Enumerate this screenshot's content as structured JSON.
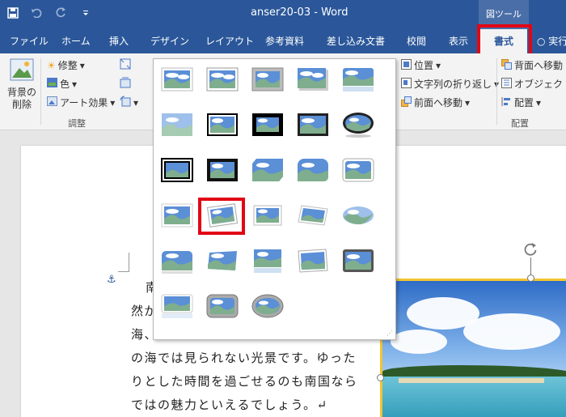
{
  "window": {
    "doc_title": "anser20-03",
    "separator": "-",
    "app_name": "Word",
    "context_tab_label": "図ツール"
  },
  "qat": {
    "save_icon": "save-icon",
    "undo_icon": "undo-icon",
    "redo_icon": "redo-icon",
    "customize_icon": "dropdown-icon"
  },
  "tabs": [
    {
      "label": "ファイル"
    },
    {
      "label": "ホーム"
    },
    {
      "label": "挿入"
    },
    {
      "label": "デザイン"
    },
    {
      "label": "レイアウト"
    },
    {
      "label": "参考資料"
    },
    {
      "label": "差し込み文書"
    },
    {
      "label": "校閲"
    },
    {
      "label": "表示"
    },
    {
      "label": "書式"
    },
    {
      "label": "実行"
    }
  ],
  "ribbon": {
    "remove_bg": {
      "line1": "背景の",
      "line2": "削除"
    },
    "corrections": "修整",
    "color": "色",
    "artistic": "アート効果",
    "group_adjust": "調整",
    "position": "位置",
    "wrap_text": "文字列の折り返し",
    "bring_forward": "前面へ移動",
    "send_backward": "背面へ移動",
    "selection_pane": "オブジェクトの",
    "align": "配置",
    "group_arrange": "配置"
  },
  "document": {
    "lines": [
      "南",
      "然が",
      "海、",
      "の海では見られない光景です。ゆった",
      "りとした時間を過ごせるのも南国なら",
      "ではの魅力といえるでしょう。↵"
    ]
  },
  "accent": {
    "title_blue": "#2b579a",
    "highlight_red": "#e20613",
    "selection_yellow": "#f2c430"
  }
}
